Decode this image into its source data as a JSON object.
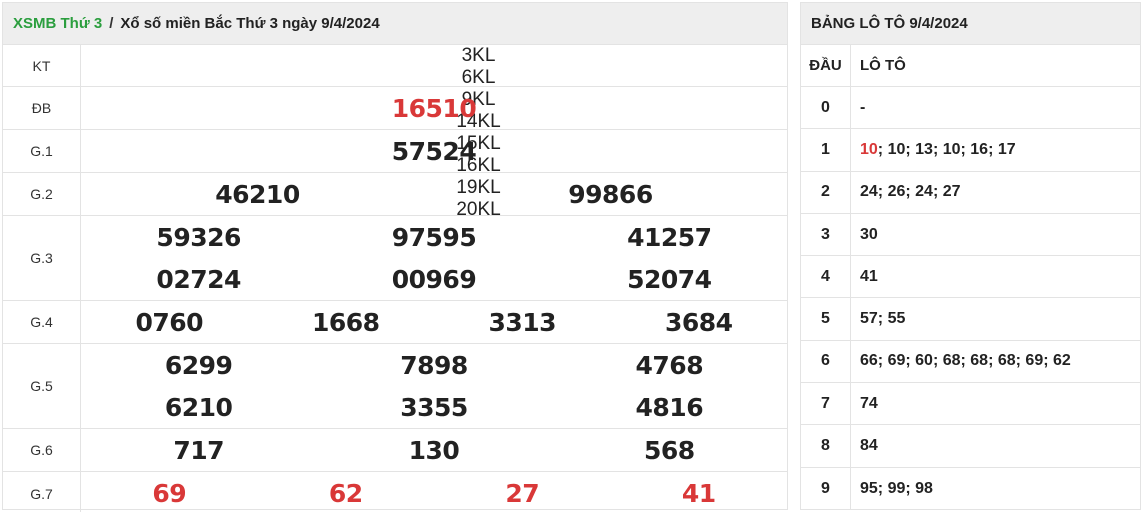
{
  "breadcrumb": {
    "link": "XSMB Thứ 3",
    "separator": "/",
    "current": "Xổ số miền Bắc Thứ 3 ngày 9/4/2024"
  },
  "results": {
    "kt": {
      "label": "KT",
      "codes": [
        "3KL",
        "6KL",
        "9KL",
        "14KL",
        "15KL",
        "16KL",
        "19KL",
        "20KL"
      ]
    },
    "prizes": [
      {
        "label": "ĐB",
        "lines": [
          [
            "16510"
          ]
        ]
      },
      {
        "label": "G.1",
        "lines": [
          [
            "57524"
          ]
        ]
      },
      {
        "label": "G.2",
        "lines": [
          [
            "46210",
            "99866"
          ]
        ]
      },
      {
        "label": "G.3",
        "lines": [
          [
            "59326",
            "97595",
            "41257"
          ],
          [
            "02724",
            "00969",
            "52074"
          ]
        ]
      },
      {
        "label": "G.4",
        "lines": [
          [
            "0760",
            "1668",
            "3313",
            "3684"
          ]
        ]
      },
      {
        "label": "G.5",
        "lines": [
          [
            "6299",
            "7898",
            "4768"
          ],
          [
            "6210",
            "3355",
            "4816"
          ]
        ]
      },
      {
        "label": "G.6",
        "lines": [
          [
            "717",
            "130",
            "568"
          ]
        ]
      },
      {
        "label": "G.7",
        "lines": [
          [
            "69",
            "62",
            "27",
            "41"
          ]
        ]
      }
    ]
  },
  "loto_table": {
    "title": "BẢNG LÔ TÔ 9/4/2024",
    "header": {
      "dau": "ĐẦU",
      "loto": "LÔ TÔ"
    },
    "rows": [
      {
        "dau": "0",
        "values": "-"
      },
      {
        "dau": "1",
        "first": "10",
        "rest": "; 10; 13; 10; 16; 17"
      },
      {
        "dau": "2",
        "values": "24; 26; 24; 27"
      },
      {
        "dau": "3",
        "values": "30"
      },
      {
        "dau": "4",
        "values": "41"
      },
      {
        "dau": "5",
        "values": "57; 55"
      },
      {
        "dau": "6",
        "values": "66; 69; 60; 68; 68; 68; 69; 62"
      },
      {
        "dau": "7",
        "values": "74"
      },
      {
        "dau": "8",
        "values": "84"
      },
      {
        "dau": "9",
        "values": "95; 99; 98"
      }
    ]
  },
  "colors": {
    "link_green": "#2b9e3e",
    "highlight_red": "#d93838",
    "header_bg": "#eeeeee",
    "border": "#e3e3e3"
  }
}
